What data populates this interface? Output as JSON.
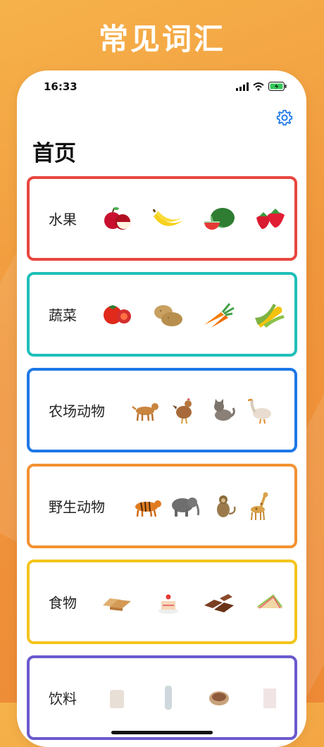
{
  "headline": "常见词汇",
  "status": {
    "time": "16:33"
  },
  "page_title": "首页",
  "categories": [
    {
      "label": "水果",
      "color": "#e84640",
      "items": [
        "apple-icon",
        "banana-icon",
        "watermelon-icon",
        "strawberry-icon"
      ]
    },
    {
      "label": "蔬菜",
      "color": "#1fbfb8",
      "items": [
        "tomato-icon",
        "potato-icon",
        "carrot-icon",
        "corn-icon"
      ]
    },
    {
      "label": "农场动物",
      "color": "#1e78e6",
      "items": [
        "dog-icon",
        "chicken-icon",
        "cat-icon",
        "goose-icon"
      ]
    },
    {
      "label": "野生动物",
      "color": "#f29232",
      "items": [
        "tiger-icon",
        "elephant-icon",
        "monkey-icon",
        "giraffe-icon"
      ]
    },
    {
      "label": "食物",
      "color": "#f4c41c",
      "items": [
        "bread-icon",
        "cake-icon",
        "chocolate-icon",
        "sandwich-icon"
      ]
    },
    {
      "label": "饮料",
      "color": "#6a5acd",
      "items": [
        "cup-icon",
        "bottle-icon",
        "coffee-icon",
        "glass-icon"
      ]
    }
  ]
}
